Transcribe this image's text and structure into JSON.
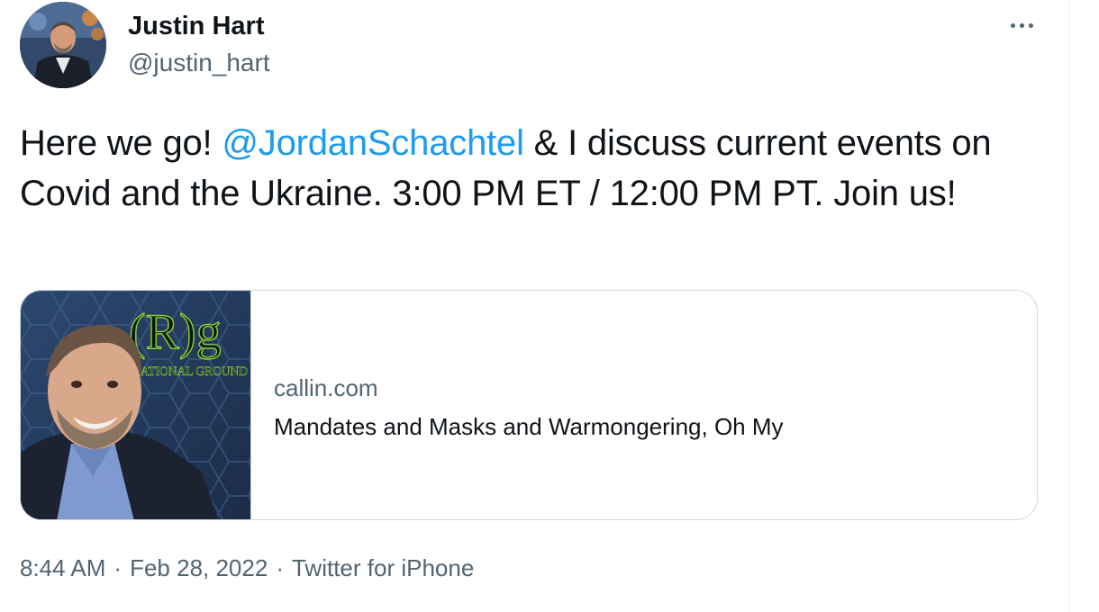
{
  "author": {
    "display_name": "Justin Hart",
    "handle": "@justin_hart",
    "avatar_icon": "profile-photo"
  },
  "more_icon": "more-options-icon",
  "tweet": {
    "text_before": "Here we go! ",
    "mention": "@JordanSchachtel",
    "text_after": " & I discuss current events on Covid and the Ukraine. 3:00 PM ET / 12:00 PM PT. Join us!"
  },
  "card": {
    "domain": "callin.com",
    "title": "Mandates and Masks and Warmongering, Oh My",
    "image": {
      "logo_text": "(R)g",
      "logo_subtext": "RATIONAL GROUND"
    }
  },
  "meta": {
    "time": "8:44 AM",
    "separator": "·",
    "date": "Feb 28, 2022",
    "source": "Twitter for iPhone"
  },
  "colors": {
    "text": "#0f1419",
    "secondary": "#536471",
    "link": "#1d9bf0",
    "border": "#cfd9de"
  }
}
